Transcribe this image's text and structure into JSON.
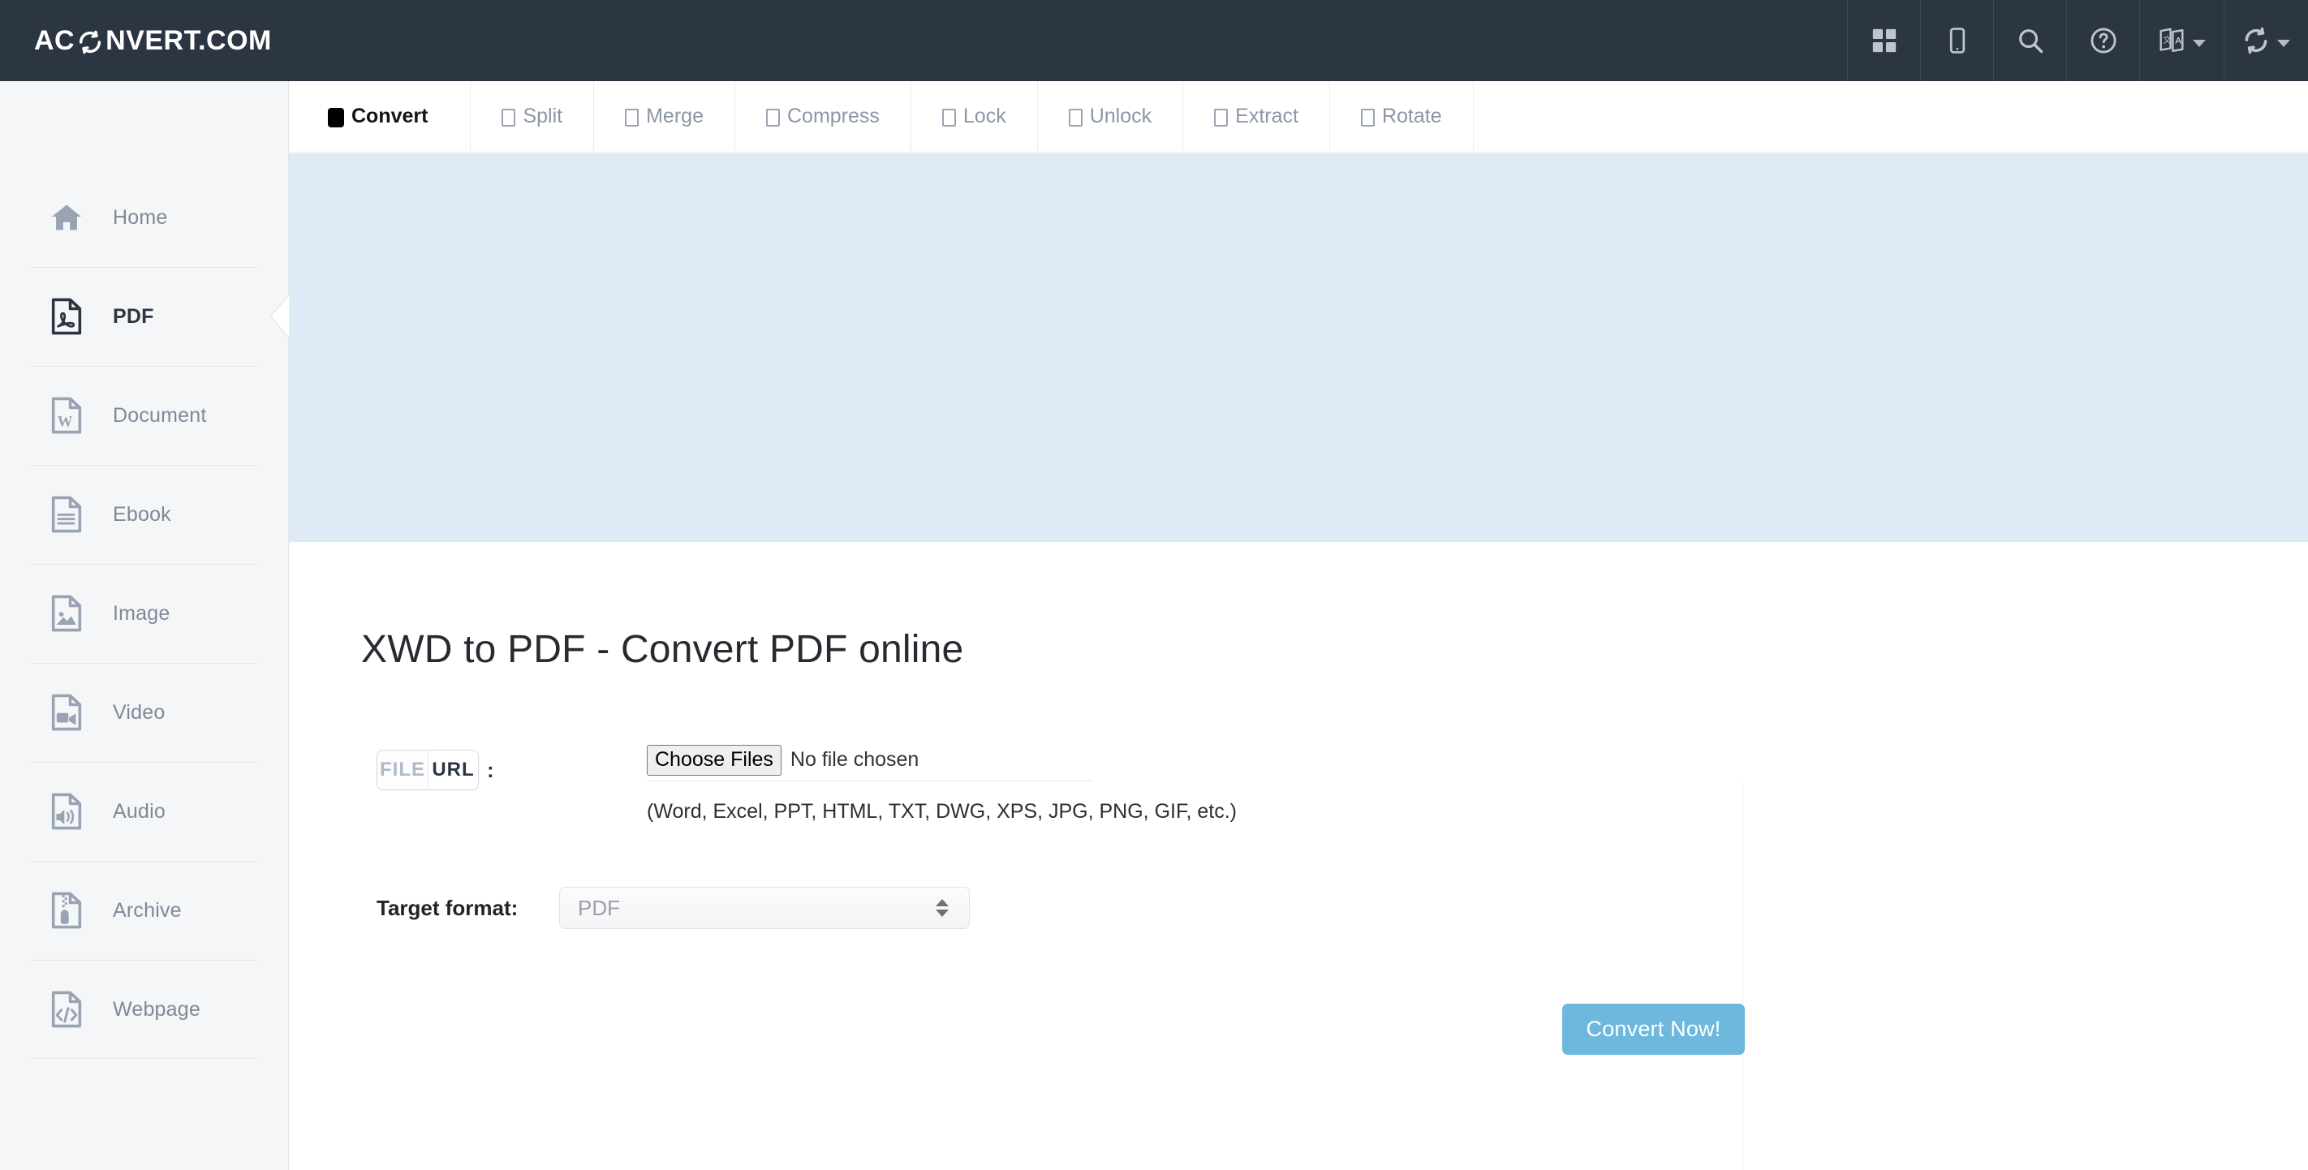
{
  "header": {
    "brand_before": "AC",
    "brand_logo_icon": "circular-arrows-icon",
    "brand_after": "NVERT.COM",
    "icons": [
      {
        "name": "apps-grid-icon",
        "label": "Apps"
      },
      {
        "name": "mobile-phone-icon",
        "label": "Mobile"
      },
      {
        "name": "search-icon",
        "label": "Search"
      },
      {
        "name": "help-circle-icon",
        "label": "Help"
      },
      {
        "name": "translate-icon",
        "label": "Language"
      },
      {
        "name": "convert-refresh-icon",
        "label": "Convert"
      }
    ]
  },
  "sidebar": {
    "items": [
      {
        "label": "Home",
        "icon": "home-icon",
        "active": false
      },
      {
        "label": "PDF",
        "icon": "pdf-file-icon",
        "active": true
      },
      {
        "label": "Document",
        "icon": "word-document-icon",
        "active": false
      },
      {
        "label": "Ebook",
        "icon": "ebook-file-icon",
        "active": false
      },
      {
        "label": "Image",
        "icon": "image-file-icon",
        "active": false
      },
      {
        "label": "Video",
        "icon": "video-file-icon",
        "active": false
      },
      {
        "label": "Audio",
        "icon": "audio-file-icon",
        "active": false
      },
      {
        "label": "Archive",
        "icon": "archive-zip-file-icon",
        "active": false
      },
      {
        "label": "Webpage",
        "icon": "code-file-icon",
        "active": false
      }
    ]
  },
  "tabs": [
    {
      "label": "Convert",
      "active": true
    },
    {
      "label": "Split",
      "active": false
    },
    {
      "label": "Merge",
      "active": false
    },
    {
      "label": "Compress",
      "active": false
    },
    {
      "label": "Lock",
      "active": false
    },
    {
      "label": "Unlock",
      "active": false
    },
    {
      "label": "Extract",
      "active": false
    },
    {
      "label": "Rotate",
      "active": false
    }
  ],
  "main": {
    "page_title": "XWD to PDF - Convert PDF online",
    "source_toggle": {
      "file_label": "FILE",
      "url_label": "URL",
      "separator": ":",
      "selected": "URL"
    },
    "file_input": {
      "button_label": "Choose Files",
      "status_text": "No file chosen",
      "hint": "(Word, Excel, PPT, HTML, TXT, DWG, XPS, JPG, PNG, GIF, etc.)"
    },
    "target_format": {
      "label": "Target format:",
      "value": "PDF"
    },
    "convert_button_label": "Convert Now!"
  },
  "colors": {
    "navbar_bg": "#2b3642",
    "sidebar_bg": "#f5f6f7",
    "banner_bg": "#deeaf6",
    "accent_button": "#6db8dc",
    "muted_text": "#7e8a99",
    "active_text": "#2b3642"
  }
}
